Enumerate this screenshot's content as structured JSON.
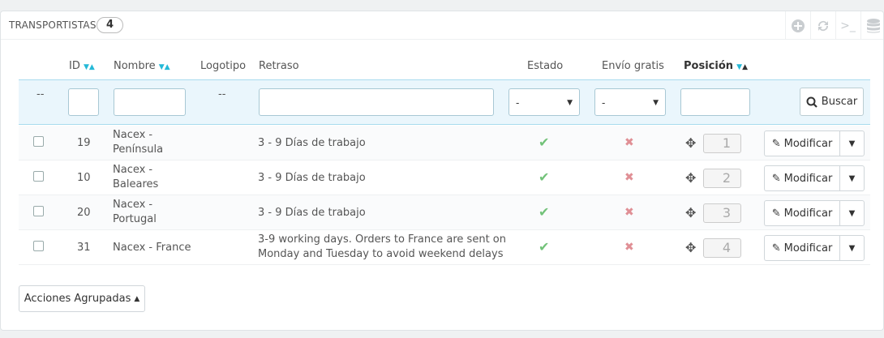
{
  "panel": {
    "title": "TRANSPORTISTAS",
    "count": "4"
  },
  "toolbar": {
    "icons": [
      "add-icon",
      "refresh-icon",
      "sql-icon",
      "database-icon"
    ],
    "sql_label": ">_"
  },
  "columns": {
    "id": "ID",
    "nombre": "Nombre",
    "logotipo": "Logotipo",
    "retraso": "Retraso",
    "estado": "Estado",
    "envio": "Envío gratis",
    "posicion": "Posición"
  },
  "filters": {
    "checkbox_placeholder": "--",
    "logo_placeholder": "--",
    "estado_value": "-",
    "envio_value": "-",
    "search_label": "Buscar"
  },
  "rows": [
    {
      "id": "19",
      "name1": "Nacex -",
      "name2": "Península",
      "delay1": "3 - 9 Días de trabajo",
      "delay2": "",
      "position": "1",
      "edit": "Modificar"
    },
    {
      "id": "10",
      "name1": "Nacex -",
      "name2": "Baleares",
      "delay1": "3 - 9 Días de trabajo",
      "delay2": "",
      "position": "2",
      "edit": "Modificar"
    },
    {
      "id": "20",
      "name1": "Nacex -",
      "name2": "Portugal",
      "delay1": "3 - 9 Días de trabajo",
      "delay2": "",
      "position": "3",
      "edit": "Modificar"
    },
    {
      "id": "31",
      "name1": "Nacex - France",
      "name2": "",
      "delay1": "3-9 working days. Orders to France are sent on",
      "delay2": "Monday and Tuesday to avoid weekend delays",
      "position": "4",
      "edit": "Modificar"
    }
  ],
  "status": {
    "estado": "enabled",
    "envio_gratis": "disabled"
  },
  "bulk": {
    "label": "Acciones Agrupadas"
  },
  "colors": {
    "accent": "#25b9d7",
    "success": "#72c279",
    "danger": "#e08f95"
  }
}
